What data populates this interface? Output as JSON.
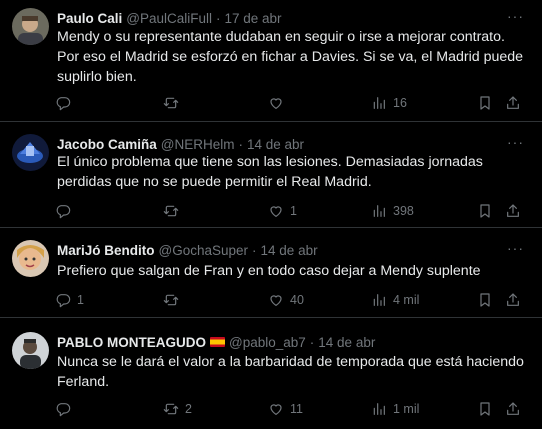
{
  "tweets": [
    {
      "name": "Paulo Cali",
      "handle": "@PaulCaliFull",
      "separator": "·",
      "time": "17 de abr",
      "text": "Mendy o su representante dudaban en seguir o irse a mejorar contrato. Por eso el Madrid se esforzó en fichar a Davies. Si se va, el Madrid puede suplirlo bien.",
      "replies": "",
      "retweets": "",
      "likes": "",
      "views": "16"
    },
    {
      "name": "Jacobo Camiña",
      "handle": "@NERHelm",
      "separator": "·",
      "time": "14 de abr",
      "text": "El único problema que tiene son las lesiones. Demasiadas jornadas perdidas que no se puede permitir el Real Madrid.",
      "replies": "",
      "retweets": "",
      "likes": "1",
      "views": "398"
    },
    {
      "name": "MariJó Bendito",
      "handle": "@GochaSuper",
      "separator": "·",
      "time": "14 de abr",
      "text": "Prefiero que salgan de Fran y en todo caso dejar a Mendy suplente",
      "replies": "1",
      "retweets": "",
      "likes": "40",
      "views": "4 mil"
    },
    {
      "name": "PABLO MONTEAGUDO",
      "handle": "@pablo_ab7",
      "separator": "·",
      "time": "14 de abr",
      "text": "Nunca se le dará el valor a la barbaridad de temporada que está haciendo Ferland.",
      "replies": "",
      "retweets": "2",
      "likes": "11",
      "views": "1 mil"
    }
  ],
  "more_glyph": "···",
  "icons": [
    "reply-icon",
    "retweet-icon",
    "like-icon",
    "views-icon",
    "bookmark-icon",
    "share-icon",
    "spain-flag-icon"
  ]
}
